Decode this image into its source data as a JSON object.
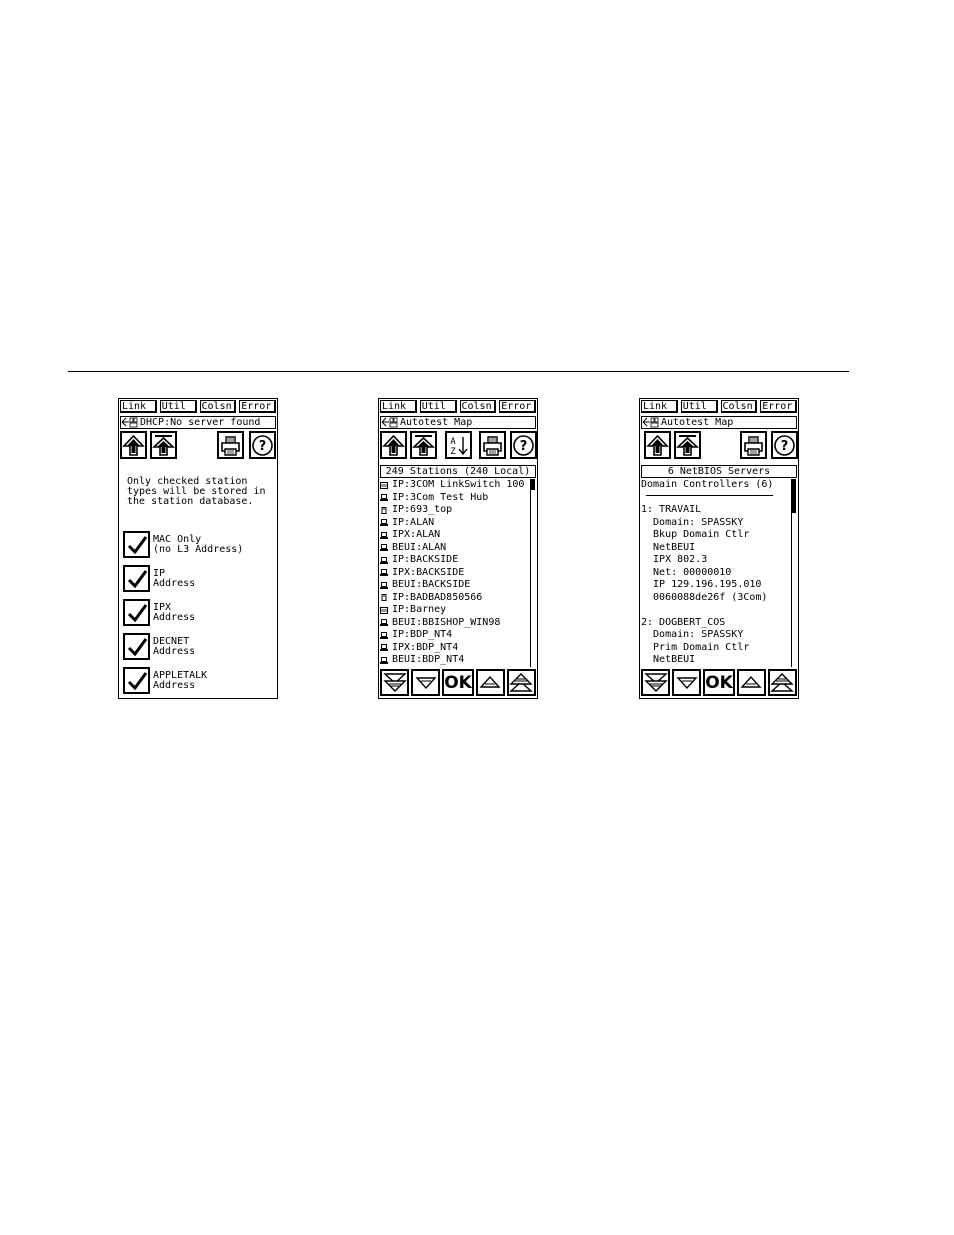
{
  "tabs": [
    "Link",
    "Util",
    "Colsn",
    "Error"
  ],
  "icons": {
    "up": "up-arrow-icon",
    "top": "top-arrow-icon",
    "sort": "sort-az-icon",
    "print": "printer-icon",
    "help": "help-icon"
  },
  "screen1": {
    "status": "DHCP:No server found",
    "intro": [
      "Only checked station",
      "types will be stored in",
      "the station database."
    ],
    "options": [
      {
        "line1": "MAC Only",
        "line2": "(no L3 Address)",
        "checked": true
      },
      {
        "line1": "IP",
        "line2": "Address",
        "checked": true
      },
      {
        "line1": "IPX",
        "line2": "Address",
        "checked": true
      },
      {
        "line1": "DECNET",
        "line2": "Address",
        "checked": true
      },
      {
        "line1": "APPLETALK",
        "line2": "Address",
        "checked": true
      }
    ]
  },
  "screen2": {
    "status": "Autotest Map",
    "banner": "249 Stations (240 Local)",
    "stations": [
      {
        "icon": "switch-icon",
        "label": "IP:3COM LinkSwitch 100"
      },
      {
        "icon": "station-icon",
        "label": "IP:3Com Test Hub"
      },
      {
        "icon": "server-icon",
        "label": "IP:693_top"
      },
      {
        "icon": "station-icon",
        "label": "IP:ALAN"
      },
      {
        "icon": "station-icon",
        "label": "IPX:ALAN"
      },
      {
        "icon": "station-icon",
        "label": "BEUI:ALAN"
      },
      {
        "icon": "station-icon",
        "label": "IP:BACKSIDE"
      },
      {
        "icon": "station-icon",
        "label": "IPX:BACKSIDE"
      },
      {
        "icon": "station-icon",
        "label": "BEUI:BACKSIDE"
      },
      {
        "icon": "server-icon",
        "label": "IP:BADBAD850566"
      },
      {
        "icon": "switch-icon",
        "label": "IP:Barney"
      },
      {
        "icon": "station-icon",
        "label": "BEUI:BBISHOP_WIN98"
      },
      {
        "icon": "station-icon",
        "label": "IP:BDP_NT4"
      },
      {
        "icon": "station-icon",
        "label": "IPX:BDP_NT4"
      },
      {
        "icon": "station-icon",
        "label": "BEUI:BDP_NT4"
      }
    ]
  },
  "screen3": {
    "status": "Autotest Map",
    "banner": "6 NetBIOS Servers",
    "lines": [
      "Domain Controllers (6)",
      "",
      "1: TRAVAIL",
      "  Domain: SPASSKY",
      "  Bkup Domain Ctlr",
      "  NetBEUI",
      "  IPX 802.3",
      "  Net: 00000010",
      "  IP 129.196.195.010",
      "  0060088de26f (3Com)",
      "",
      "2: DOGBERT_COS",
      "  Domain: SPASSKY",
      "  Prim Domain Ctlr",
      "  NetBEUI"
    ]
  },
  "nav": {
    "ok": "OK"
  }
}
